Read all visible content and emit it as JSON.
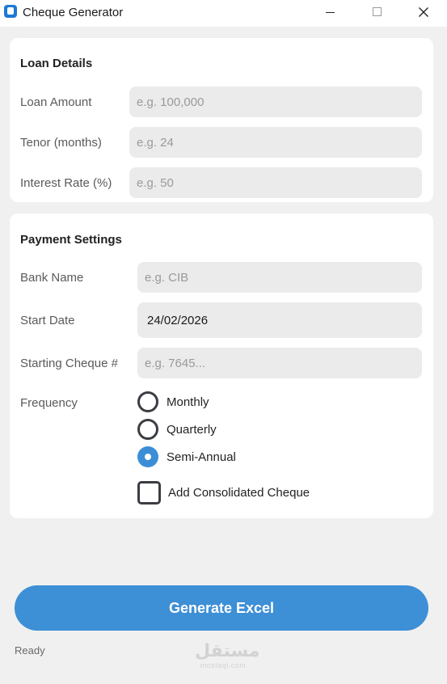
{
  "window": {
    "title": "Cheque Generator"
  },
  "loan_details": {
    "title": "Loan Details",
    "fields": [
      {
        "label": "Loan Amount",
        "value": "",
        "placeholder": "e.g. 100,000"
      },
      {
        "label": "Tenor (months)",
        "value": "",
        "placeholder": "e.g. 24"
      },
      {
        "label": "Interest Rate (%)",
        "value": "",
        "placeholder": "e.g. 50"
      }
    ]
  },
  "payment_settings": {
    "title": "Payment Settings",
    "fields": [
      {
        "label": "Bank Name",
        "value": "",
        "placeholder": "e.g. CIB"
      },
      {
        "label": "Start Date",
        "value": "24/02/2026",
        "placeholder": ""
      },
      {
        "label": "Starting Cheque #",
        "value": "",
        "placeholder": "e.g. 7645..."
      }
    ],
    "frequency": {
      "label": "Frequency",
      "options": [
        "Monthly",
        "Quarterly",
        "Semi-Annual"
      ],
      "selected": "Semi-Annual"
    },
    "consolidated": {
      "label": "Add Consolidated Cheque",
      "checked": false
    }
  },
  "actions": {
    "generate_label": "Generate Excel"
  },
  "status": {
    "text": "Ready"
  },
  "watermark": {
    "arabic": "مستقل",
    "latin": "mostaql.com"
  },
  "colors": {
    "accent": "#3d8fd6",
    "background": "#f0f0f0",
    "card": "#ffffff",
    "input": "#ebebeb"
  },
  "icons": {
    "app": "app-icon",
    "minimize": "minimize-icon",
    "maximize": "maximize-icon",
    "close": "close-icon"
  }
}
